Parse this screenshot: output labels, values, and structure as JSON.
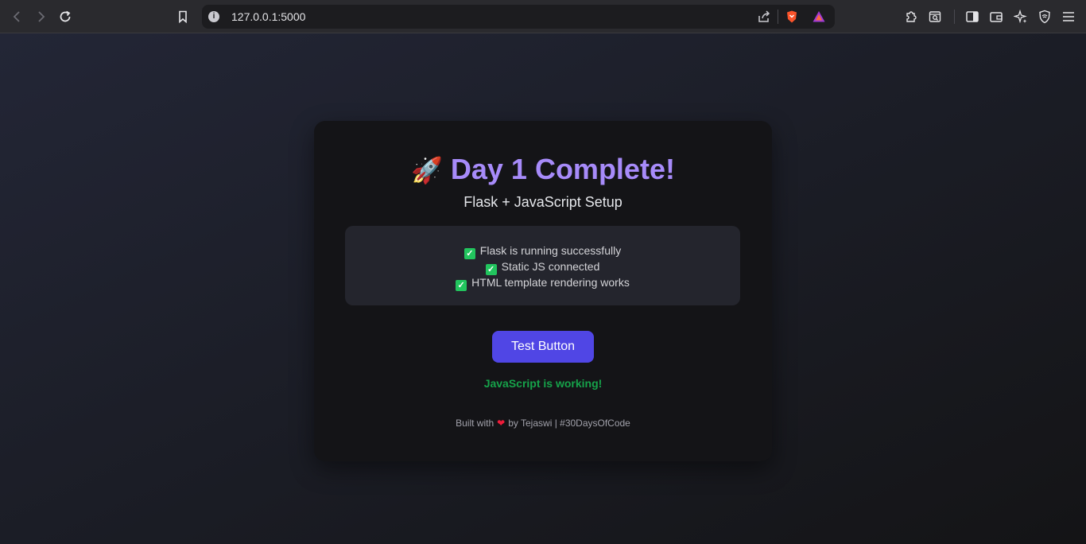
{
  "browser": {
    "url": "127.0.0.1:5000",
    "info_icon": "i"
  },
  "card": {
    "title_icon": "🚀",
    "title": "Day 1 Complete!",
    "subtitle": "Flask + JavaScript Setup",
    "checks": [
      {
        "icon": "✓",
        "text": "Flask is running successfully"
      },
      {
        "icon": "✓",
        "text": "Static JS connected"
      },
      {
        "icon": "✓",
        "text": "HTML template rendering works"
      }
    ],
    "button_label": "Test Button",
    "status": "JavaScript is working!",
    "footer": {
      "prefix": "Built with",
      "heart": "❤",
      "suffix": "by Tejaswi | #30DaysOfCode"
    }
  },
  "colors": {
    "accent": "#a78bfa",
    "button": "#5046e5",
    "success": "#16a34a",
    "check": "#22c55e",
    "heart": "#ef1c3a"
  }
}
